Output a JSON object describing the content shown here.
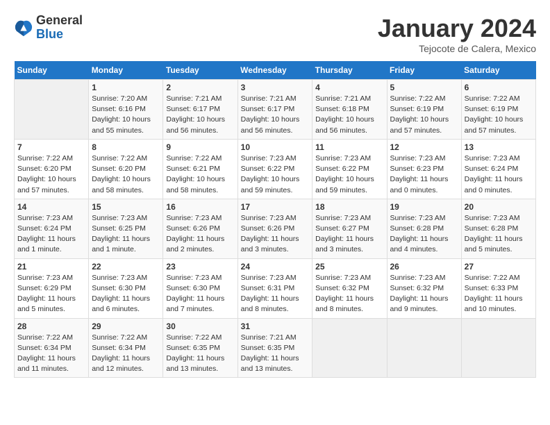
{
  "logo": {
    "general": "General",
    "blue": "Blue"
  },
  "title": "January 2024",
  "location": "Tejocote de Calera, Mexico",
  "days_header": [
    "Sunday",
    "Monday",
    "Tuesday",
    "Wednesday",
    "Thursday",
    "Friday",
    "Saturday"
  ],
  "weeks": [
    [
      {
        "day": "",
        "info": ""
      },
      {
        "day": "1",
        "info": "Sunrise: 7:20 AM\nSunset: 6:16 PM\nDaylight: 10 hours\nand 55 minutes."
      },
      {
        "day": "2",
        "info": "Sunrise: 7:21 AM\nSunset: 6:17 PM\nDaylight: 10 hours\nand 56 minutes."
      },
      {
        "day": "3",
        "info": "Sunrise: 7:21 AM\nSunset: 6:17 PM\nDaylight: 10 hours\nand 56 minutes."
      },
      {
        "day": "4",
        "info": "Sunrise: 7:21 AM\nSunset: 6:18 PM\nDaylight: 10 hours\nand 56 minutes."
      },
      {
        "day": "5",
        "info": "Sunrise: 7:22 AM\nSunset: 6:19 PM\nDaylight: 10 hours\nand 57 minutes."
      },
      {
        "day": "6",
        "info": "Sunrise: 7:22 AM\nSunset: 6:19 PM\nDaylight: 10 hours\nand 57 minutes."
      }
    ],
    [
      {
        "day": "7",
        "info": "Sunrise: 7:22 AM\nSunset: 6:20 PM\nDaylight: 10 hours\nand 57 minutes."
      },
      {
        "day": "8",
        "info": "Sunrise: 7:22 AM\nSunset: 6:20 PM\nDaylight: 10 hours\nand 58 minutes."
      },
      {
        "day": "9",
        "info": "Sunrise: 7:22 AM\nSunset: 6:21 PM\nDaylight: 10 hours\nand 58 minutes."
      },
      {
        "day": "10",
        "info": "Sunrise: 7:23 AM\nSunset: 6:22 PM\nDaylight: 10 hours\nand 59 minutes."
      },
      {
        "day": "11",
        "info": "Sunrise: 7:23 AM\nSunset: 6:22 PM\nDaylight: 10 hours\nand 59 minutes."
      },
      {
        "day": "12",
        "info": "Sunrise: 7:23 AM\nSunset: 6:23 PM\nDaylight: 11 hours\nand 0 minutes."
      },
      {
        "day": "13",
        "info": "Sunrise: 7:23 AM\nSunset: 6:24 PM\nDaylight: 11 hours\nand 0 minutes."
      }
    ],
    [
      {
        "day": "14",
        "info": "Sunrise: 7:23 AM\nSunset: 6:24 PM\nDaylight: 11 hours\nand 1 minute."
      },
      {
        "day": "15",
        "info": "Sunrise: 7:23 AM\nSunset: 6:25 PM\nDaylight: 11 hours\nand 1 minute."
      },
      {
        "day": "16",
        "info": "Sunrise: 7:23 AM\nSunset: 6:26 PM\nDaylight: 11 hours\nand 2 minutes."
      },
      {
        "day": "17",
        "info": "Sunrise: 7:23 AM\nSunset: 6:26 PM\nDaylight: 11 hours\nand 3 minutes."
      },
      {
        "day": "18",
        "info": "Sunrise: 7:23 AM\nSunset: 6:27 PM\nDaylight: 11 hours\nand 3 minutes."
      },
      {
        "day": "19",
        "info": "Sunrise: 7:23 AM\nSunset: 6:28 PM\nDaylight: 11 hours\nand 4 minutes."
      },
      {
        "day": "20",
        "info": "Sunrise: 7:23 AM\nSunset: 6:28 PM\nDaylight: 11 hours\nand 5 minutes."
      }
    ],
    [
      {
        "day": "21",
        "info": "Sunrise: 7:23 AM\nSunset: 6:29 PM\nDaylight: 11 hours\nand 5 minutes."
      },
      {
        "day": "22",
        "info": "Sunrise: 7:23 AM\nSunset: 6:30 PM\nDaylight: 11 hours\nand 6 minutes."
      },
      {
        "day": "23",
        "info": "Sunrise: 7:23 AM\nSunset: 6:30 PM\nDaylight: 11 hours\nand 7 minutes."
      },
      {
        "day": "24",
        "info": "Sunrise: 7:23 AM\nSunset: 6:31 PM\nDaylight: 11 hours\nand 8 minutes."
      },
      {
        "day": "25",
        "info": "Sunrise: 7:23 AM\nSunset: 6:32 PM\nDaylight: 11 hours\nand 8 minutes."
      },
      {
        "day": "26",
        "info": "Sunrise: 7:23 AM\nSunset: 6:32 PM\nDaylight: 11 hours\nand 9 minutes."
      },
      {
        "day": "27",
        "info": "Sunrise: 7:22 AM\nSunset: 6:33 PM\nDaylight: 11 hours\nand 10 minutes."
      }
    ],
    [
      {
        "day": "28",
        "info": "Sunrise: 7:22 AM\nSunset: 6:34 PM\nDaylight: 11 hours\nand 11 minutes."
      },
      {
        "day": "29",
        "info": "Sunrise: 7:22 AM\nSunset: 6:34 PM\nDaylight: 11 hours\nand 12 minutes."
      },
      {
        "day": "30",
        "info": "Sunrise: 7:22 AM\nSunset: 6:35 PM\nDaylight: 11 hours\nand 13 minutes."
      },
      {
        "day": "31",
        "info": "Sunrise: 7:21 AM\nSunset: 6:35 PM\nDaylight: 11 hours\nand 13 minutes."
      },
      {
        "day": "",
        "info": ""
      },
      {
        "day": "",
        "info": ""
      },
      {
        "day": "",
        "info": ""
      }
    ]
  ]
}
